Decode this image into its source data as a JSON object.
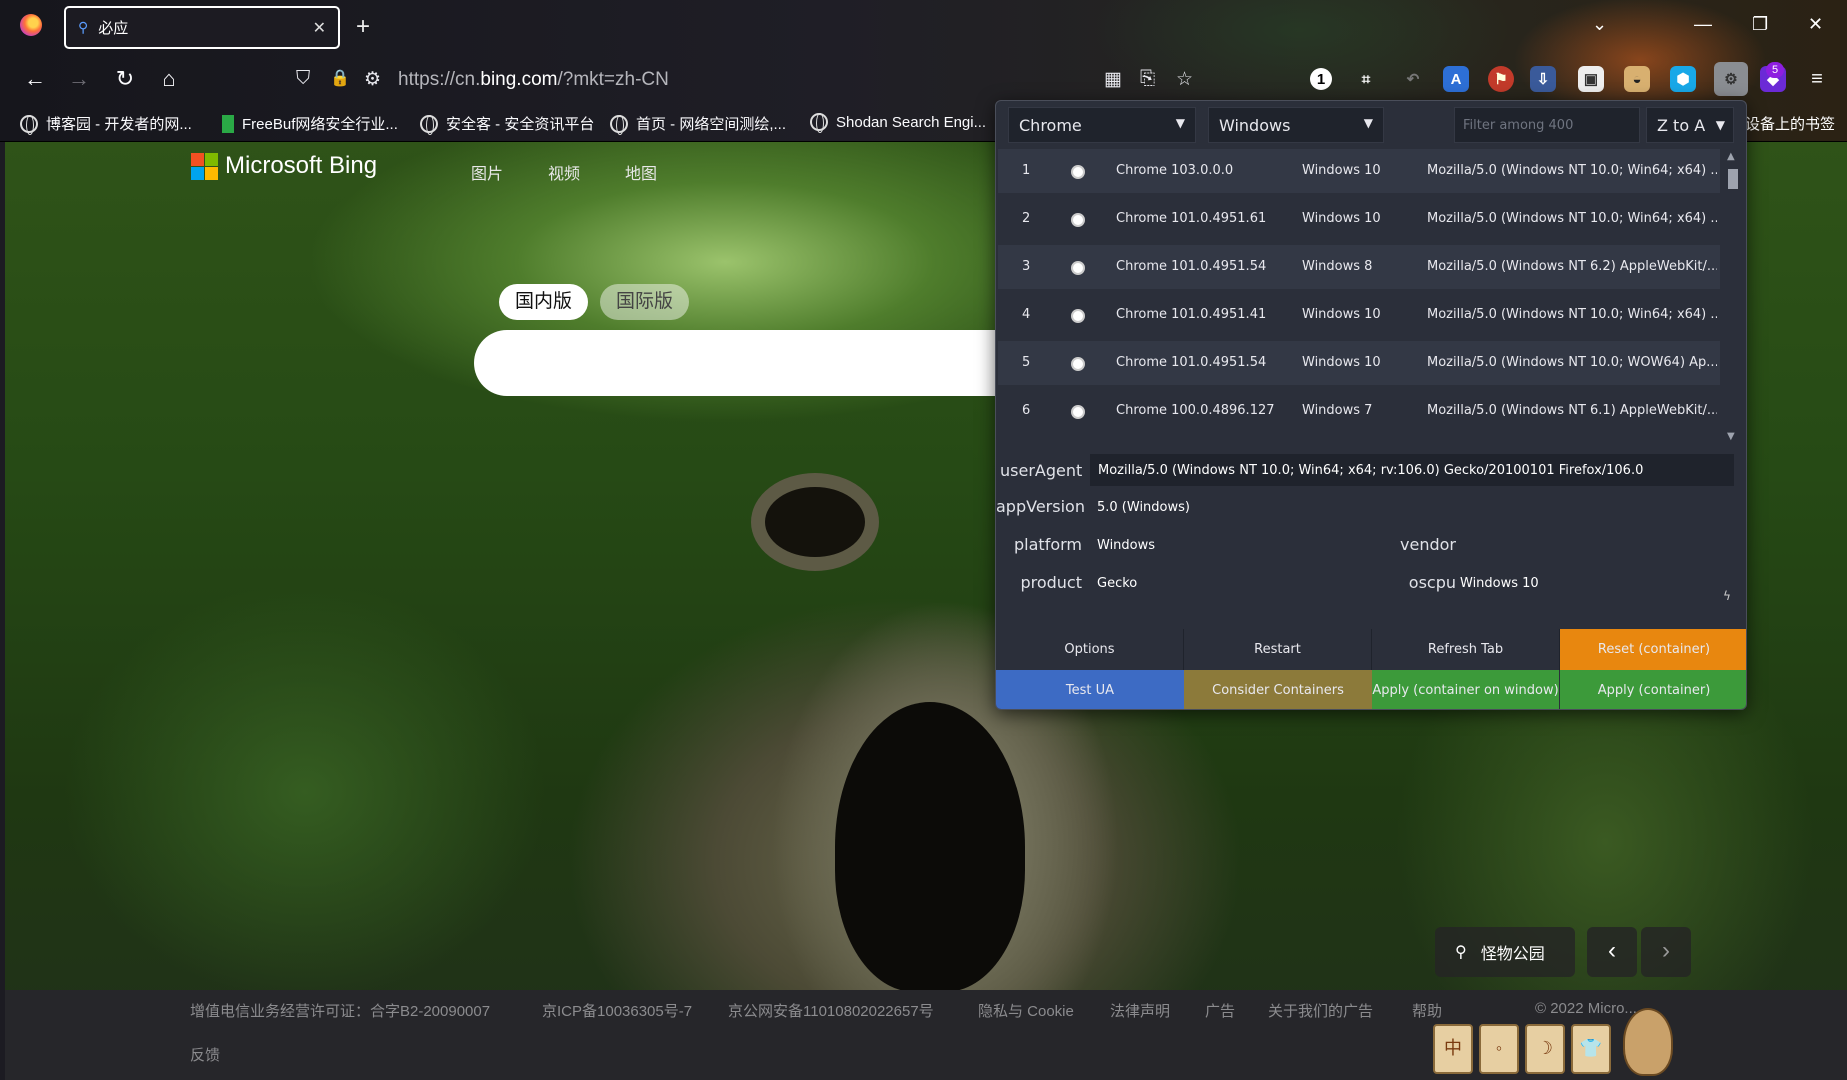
{
  "browser": {
    "tab_title": "必应",
    "url_prefix": "https://cn.",
    "url_domain": "bing.com",
    "url_suffix": "/?mkt=zh-CN",
    "extension_badge": "5",
    "bookmarks": [
      "博客园 - 开发者的网...",
      "FreeBuf网络安全行业...",
      "安全客 - 安全资讯平台",
      "首页 - 网络空间测绘,...",
      "Shodan Search Engi..."
    ],
    "bookmarks_right": "设备上的书签",
    "icons": {
      "search": "⚲",
      "close": "✕",
      "new_tab": "+",
      "back": "←",
      "forward": "→",
      "reload": "↻",
      "home": "⌂",
      "shield": "⛉",
      "lock": "🔒",
      "star": "☆",
      "menu": "≡",
      "min": "—",
      "max": "❐",
      "win_close": "✕",
      "chevron": "⌄"
    }
  },
  "bing": {
    "logo_text": "Microsoft Bing",
    "nav": [
      "图片",
      "视频",
      "地图"
    ],
    "tab_domestic": "国内版",
    "tab_international": "国际版",
    "location_label": "怪物公园",
    "footer_links": [
      "增值电信业务经营许可证：合字B2-20090007",
      "京ICP备10036305号-7",
      "京公网安备11010802022657号",
      "隐私与 Cookie",
      "法律声明",
      "广告",
      "关于我们的广告",
      "帮助",
      "© 2022 Micro..."
    ],
    "footer_feedback": "反馈",
    "footer_tiles": [
      "中",
      "◦",
      "☽",
      "👕"
    ],
    "logo_colors": [
      "#f25022",
      "#7fba00",
      "#00a4ef",
      "#ffb900"
    ]
  },
  "ua_switcher": {
    "browser_select": "Chrome",
    "os_select": "Windows",
    "filter_placeholder": "Filter among 400",
    "sort_select": "Z to A",
    "rows": [
      {
        "num": "1",
        "browser": "Chrome 103.0.0.0",
        "os": "Windows 10",
        "ua": "Mozilla/5.0 (Windows NT 10.0; Win64; x64) ..."
      },
      {
        "num": "2",
        "browser": "Chrome 101.0.4951.61",
        "os": "Windows 10",
        "ua": "Mozilla/5.0 (Windows NT 10.0; Win64; x64) ..."
      },
      {
        "num": "3",
        "browser": "Chrome 101.0.4951.54",
        "os": "Windows 8",
        "ua": "Mozilla/5.0 (Windows NT 6.2) AppleWebKit/..."
      },
      {
        "num": "4",
        "browser": "Chrome 101.0.4951.41",
        "os": "Windows 10",
        "ua": "Mozilla/5.0 (Windows NT 10.0; Win64; x64) ..."
      },
      {
        "num": "5",
        "browser": "Chrome 101.0.4951.54",
        "os": "Windows 10",
        "ua": "Mozilla/5.0 (Windows NT 10.0; WOW64) Ap..."
      },
      {
        "num": "6",
        "browser": "Chrome 100.0.4896.127",
        "os": "Windows 7",
        "ua": "Mozilla/5.0 (Windows NT 6.1) AppleWebKit/..."
      }
    ],
    "labels": {
      "userAgent": "userAgent",
      "appVersion": "appVersion",
      "platform": "platform",
      "vendor": "vendor",
      "product": "product",
      "oscpu": "oscpu"
    },
    "values": {
      "userAgent": "Mozilla/5.0 (Windows NT 10.0; Win64; x64; rv:106.0) Gecko/20100101 Firefox/106.0",
      "appVersion": "5.0 (Windows)",
      "platform": "Windows",
      "vendor": "",
      "product": "Gecko",
      "oscpu": "Windows 10"
    },
    "buttons": {
      "options": "Options",
      "restart": "Restart",
      "refresh_tab": "Refresh Tab",
      "reset_container": "Reset (container)",
      "test_ua": "Test UA",
      "consider_containers": "Consider Containers",
      "apply_container_window": "Apply (container on window)",
      "apply_container": "Apply (container)"
    },
    "button_colors": {
      "default": "#2b2f3a",
      "orange": "#e8870f",
      "blue": "#3d6bc4",
      "olive": "#8c7a3a",
      "green": "#3c9a3a"
    }
  }
}
